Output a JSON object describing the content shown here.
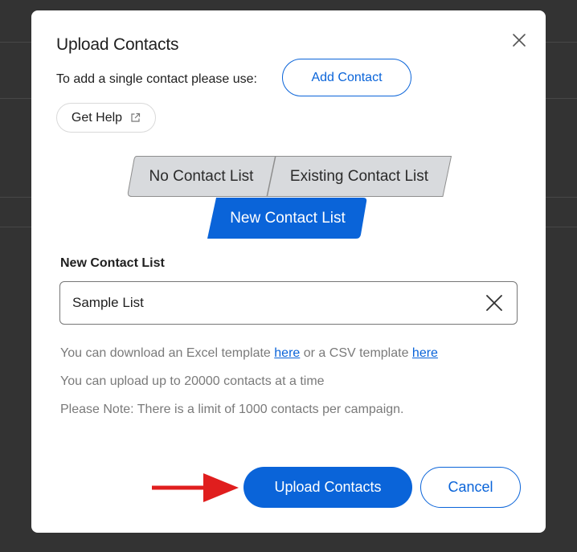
{
  "dialog": {
    "title": "Upload Contacts",
    "intro_text": "To add a single contact please use:",
    "add_contact_label": "Add Contact",
    "help_label": "Get Help",
    "close_icon": "close-icon",
    "help_icon": "external-link-icon"
  },
  "list_type": {
    "options": [
      "No Contact List",
      "Existing Contact List",
      "New Contact List"
    ],
    "selected": "New Contact List"
  },
  "new_list": {
    "label": "New Contact List",
    "value": "Sample List",
    "clear_icon": "clear-icon"
  },
  "info": {
    "template_prefix": "You can download an Excel template ",
    "excel_link": "here",
    "template_middle": " or a CSV template ",
    "csv_link": "here",
    "limit_upload": "You can upload up to 20000 contacts at a time",
    "limit_campaign": "Please Note: There is a limit of 1000 contacts per campaign."
  },
  "footer": {
    "upload_label": "Upload Contacts",
    "cancel_label": "Cancel"
  },
  "colors": {
    "accent": "#0a64d9",
    "segment_inactive": "#d8dadd",
    "annotation_arrow": "#e01e1e",
    "backdrop": "#333333"
  }
}
